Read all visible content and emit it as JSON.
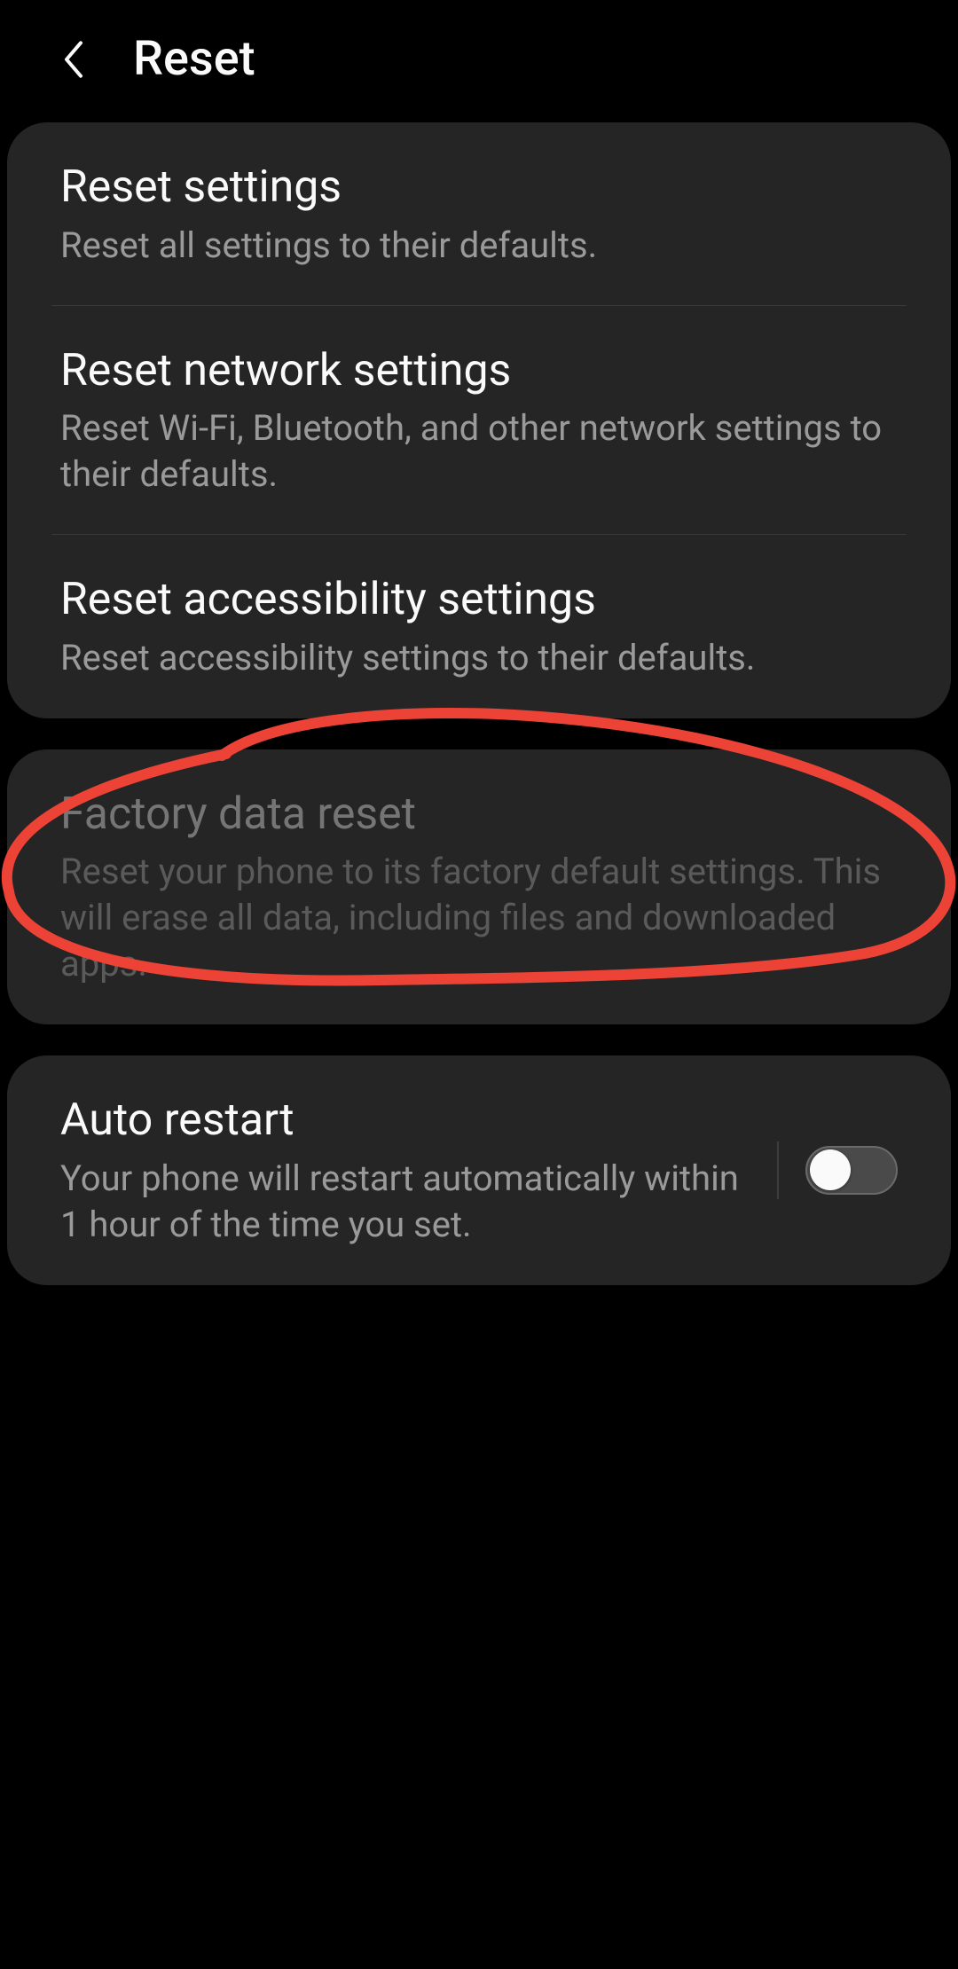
{
  "header": {
    "title": "Reset"
  },
  "card1": {
    "items": [
      {
        "title": "Reset settings",
        "desc": "Reset all settings to their defaults."
      },
      {
        "title": "Reset network settings",
        "desc": "Reset Wi-Fi, Bluetooth, and other network settings to their defaults."
      },
      {
        "title": "Reset accessibility settings",
        "desc": "Reset accessibility settings to their defaults."
      }
    ]
  },
  "card2": {
    "items": [
      {
        "title": "Factory data reset",
        "desc": "Reset your phone to its factory default settings. This will erase all data, including files and downloaded apps."
      }
    ]
  },
  "card3": {
    "items": [
      {
        "title": "Auto restart",
        "desc": "Your phone will restart automatically within 1 hour of the time you set.",
        "toggle": false
      }
    ]
  },
  "annotation": {
    "color": "#ed4337"
  }
}
